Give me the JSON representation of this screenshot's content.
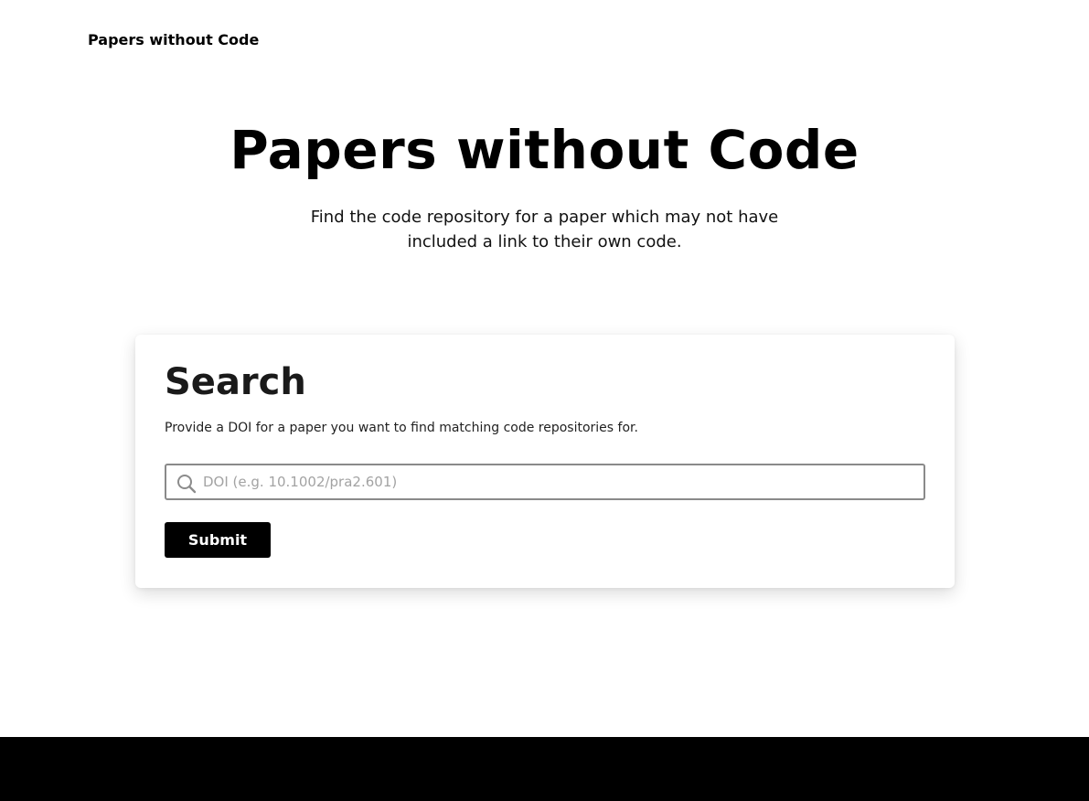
{
  "header": {
    "brand": "Papers without Code"
  },
  "hero": {
    "title": "Papers without Code",
    "subtitle": "Find the code repository for a paper which may not have included a link to their own code."
  },
  "search_card": {
    "title": "Search",
    "description": "Provide a DOI for a paper you want to find matching code repositories for.",
    "input_value": "",
    "input_placeholder": "DOI (e.g. 10.1002/pra2.601)",
    "icon": "search-icon",
    "submit_label": "Submit"
  },
  "colors": {
    "primary": "#000000",
    "background": "#ffffff",
    "footer": "#000000"
  }
}
